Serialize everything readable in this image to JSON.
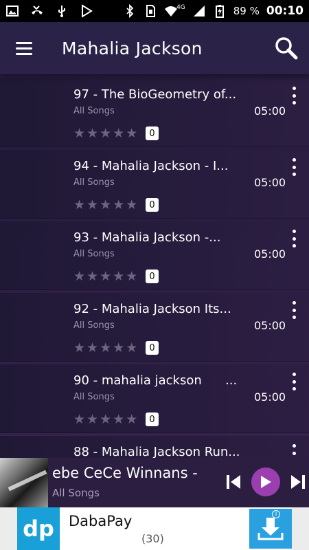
{
  "status_bar": {
    "battery": "89 %",
    "network": "4G",
    "time": "00:10"
  },
  "app_bar": {
    "title": "Mahalia Jackson"
  },
  "songs": [
    {
      "title": "97 - The BioGeometry of...",
      "subtitle": "All Songs",
      "duration": "05:00",
      "rating_count": "0"
    },
    {
      "title": "94 - Mahalia Jackson - I...",
      "subtitle": "All Songs",
      "duration": "05:00",
      "rating_count": "0"
    },
    {
      "title": "93 - Mahalia Jackson -...",
      "subtitle": "All Songs",
      "duration": "05:00",
      "rating_count": "0"
    },
    {
      "title": "92 - Mahalia Jackson Its...",
      "subtitle": "All Songs",
      "duration": "05:00",
      "rating_count": "0"
    },
    {
      "title": "90 - mahalia jackson      ...",
      "subtitle": "All Songs",
      "duration": "05:00",
      "rating_count": "0"
    },
    {
      "title": "88 - Mahalia Jackson Run...",
      "subtitle": "",
      "duration": "",
      "rating_count": ""
    }
  ],
  "now_playing": {
    "title": "ebe  CeCe Winnans -",
    "subtitle": "All Songs"
  },
  "ad": {
    "name": "DabaPay",
    "count": "(30)",
    "logo_text": "dp"
  },
  "colors": {
    "accent": "#9b3fb0",
    "ad_blue": "#2ba0e0"
  }
}
